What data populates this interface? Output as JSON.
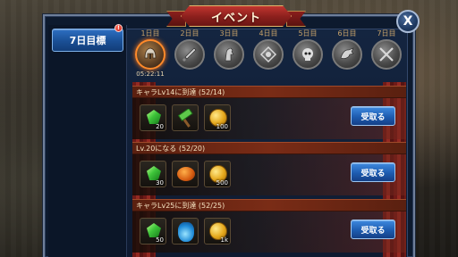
{
  "title": "イベント",
  "close_label": "X",
  "left_tab": {
    "label": "7日目標",
    "badge": "!"
  },
  "days": [
    {
      "label": "1日目",
      "icon": "helmet-icon",
      "date": "05:22:11",
      "active": true
    },
    {
      "label": "2日目",
      "icon": "sword-icon",
      "date": "",
      "active": false
    },
    {
      "label": "3日目",
      "icon": "horse-icon",
      "date": "",
      "active": false
    },
    {
      "label": "4日目",
      "icon": "emblem-icon",
      "date": "",
      "active": false
    },
    {
      "label": "5日目",
      "icon": "skull-icon",
      "date": "",
      "active": false
    },
    {
      "label": "6日目",
      "icon": "dragon-icon",
      "date": "",
      "active": false
    },
    {
      "label": "7日目",
      "icon": "crossed-swords-icon",
      "date": "",
      "active": false
    }
  ],
  "missions": [
    {
      "title": "キャラLv14に到達 (52/14)",
      "button": "受取る",
      "rewards": [
        {
          "icon": "green-gem-icon",
          "count": "20"
        },
        {
          "icon": "hammer-icon",
          "count": ""
        },
        {
          "icon": "gold-coin-icon",
          "count": "100"
        }
      ]
    },
    {
      "title": "Lv.20になる (52/20)",
      "button": "受取る",
      "rewards": [
        {
          "icon": "green-gem-icon",
          "count": "30"
        },
        {
          "icon": "fruit-icon",
          "count": ""
        },
        {
          "icon": "gold-coin-icon",
          "count": "500"
        }
      ]
    },
    {
      "title": "キャラLv25に到達 (52/25)",
      "button": "受取る",
      "rewards": [
        {
          "icon": "green-gem-icon",
          "count": "50"
        },
        {
          "icon": "potion-icon",
          "count": ""
        },
        {
          "icon": "gold-coin-icon",
          "count": "1k"
        }
      ]
    }
  ],
  "colors": {
    "accent_blue": "#1d5cb0",
    "ribbon_red": "#8a1f1c",
    "active_orange": "#ff8a2a"
  }
}
